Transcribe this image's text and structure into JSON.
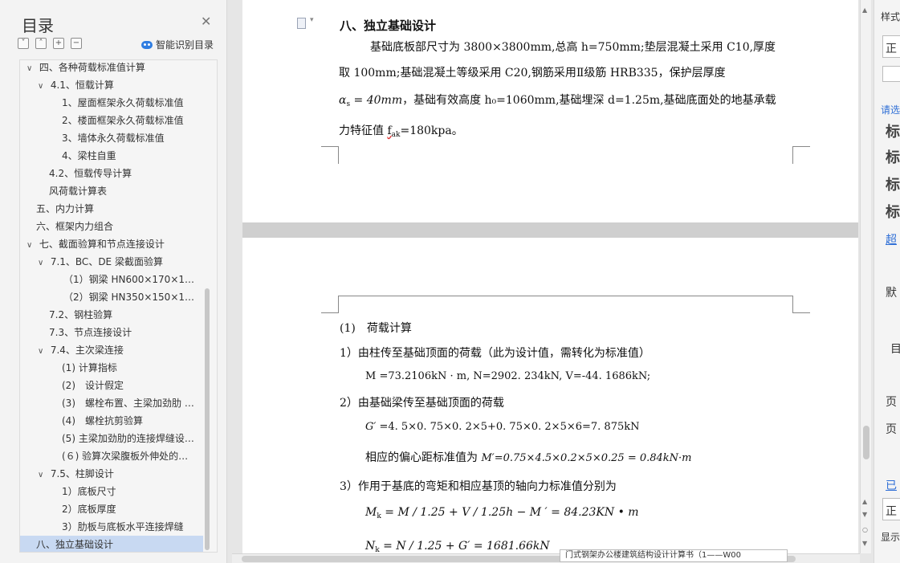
{
  "toc": {
    "title": "目录",
    "smart_label": "智能识别目录",
    "items": [
      {
        "label": "四、各种荷载标准值计算",
        "level": 1,
        "arrow": "∨"
      },
      {
        "label": "4.1、恒载计算",
        "level": 2,
        "arrow": "∨"
      },
      {
        "label": "1、屋面框架永久荷载标准值",
        "level": 3,
        "arrow": ""
      },
      {
        "label": "2、楼面框架永久荷载标准值",
        "level": 3,
        "arrow": ""
      },
      {
        "label": "3、墙体永久荷载标准值",
        "level": 3,
        "arrow": ""
      },
      {
        "label": "4、梁柱自重",
        "level": 3,
        "arrow": ""
      },
      {
        "label": "4.2、恒载传导计算",
        "level": 2,
        "arrow": ""
      },
      {
        "label": "风荷载计算表",
        "level": 2,
        "arrow": ""
      },
      {
        "label": "五、内力计算",
        "level": 1,
        "arrow": ""
      },
      {
        "label": "六、框架内力组合",
        "level": 1,
        "arrow": ""
      },
      {
        "label": "七、截面验算和节点连接设计",
        "level": 1,
        "arrow": "∨"
      },
      {
        "label": "7.1、BC、DE 梁截面验算",
        "level": 2,
        "arrow": "∨"
      },
      {
        "label": "（1）钢梁 HN600×170×16…",
        "level": 3,
        "arrow": ""
      },
      {
        "label": "（2）钢梁 HN350×150×12…",
        "level": 3,
        "arrow": ""
      },
      {
        "label": "7.2、钢柱验算",
        "level": 2,
        "arrow": ""
      },
      {
        "label": "7.3、节点连接设计",
        "level": 2,
        "arrow": ""
      },
      {
        "label": "7.4、主次梁连接",
        "level": 2,
        "arrow": "∨"
      },
      {
        "label": "(1) 计算指标",
        "level": 3,
        "arrow": ""
      },
      {
        "label": "(2)　设计假定",
        "level": 3,
        "arrow": ""
      },
      {
        "label": "(3)　螺栓布置、主梁加劲肋 …",
        "level": 3,
        "arrow": ""
      },
      {
        "label": "(4)　螺栓抗剪验算",
        "level": 3,
        "arrow": ""
      },
      {
        "label": "(5) 主梁加劲肋的连接焊缝设…",
        "level": 3,
        "arrow": ""
      },
      {
        "label": "(６) 验算次梁腹板外伸处的…",
        "level": 3,
        "arrow": ""
      },
      {
        "label": "7.5、柱脚设计",
        "level": 2,
        "arrow": "∨"
      },
      {
        "label": "1）底板尺寸",
        "level": 3,
        "arrow": ""
      },
      {
        "label": "2）底板厚度",
        "level": 3,
        "arrow": ""
      },
      {
        "label": "3）肋板与底板水平连接焊缝",
        "level": 3,
        "arrow": ""
      },
      {
        "label": "八、独立基础设计",
        "level": 1,
        "arrow": "",
        "active": true
      }
    ]
  },
  "page1": {
    "heading": "八、独立基础设计",
    "line1": "基础底板部尺寸为 3800×3800mm,总高 h=750mm;垫层混凝土采用 C10,厚度",
    "line2": "取 100mm;基础混凝土等级采用 C20,钢筋采用Ⅱ级筋 HRB335，保护层厚度",
    "line3_math": "α",
    "line3_sub": "s",
    "line3_eq": " = 40mm",
    "line3_rest": "，基础有效高度 h₀=1060mm,基础埋深 d=1.25m,基础底面处的地基承载",
    "line4_pre": "力特征值 ",
    "line4_f": "f",
    "line4_sub": "ak",
    "line4_post": "=180kpa。"
  },
  "page2": {
    "sec_title": "(1)　荷载计算",
    "item1": "1）由柱传至基础顶面的荷载（此为设计值，需转化为标准值）",
    "eq1": "M =73.2106kN · m, N=2902. 234kN, V=-44. 1686kN;",
    "item2": "2）由基础梁传至基础顶面的荷载",
    "eq2_g": "G′",
    "eq2": " =4. 5×0. 75×0. 2×5+0. 75×0. 2×5×6=7. 875kN",
    "eq3_pre": "相应的偏心距标准值为 ",
    "eq3": "M′=0.75×4.5×0.2×5×0.25 = 0.84kN·m",
    "item3": "3）作用于基底的弯矩和相应基顶的轴向力标准值分别为",
    "eq4": "M",
    "eq4_sub": "k",
    "eq4_rest": " = M / 1.25 + V / 1.25h − M ′ = 84.23KN • m",
    "eq5": "N",
    "eq5_sub": "k",
    "eq5_rest": " = N / 1.25 + G′ = 1681.66kN"
  },
  "bottom": {
    "tab_tip": "门式钢架办公楼建筑结构设计计算书（1——W00"
  },
  "right": {
    "styles": "样式",
    "box1": "正",
    "req": "请选",
    "s1": "标",
    "s2": "标",
    "s3": "标",
    "s4": "标",
    "link": "超",
    "def": "默",
    "mark": "目",
    "f1": "页",
    "f2": "页",
    "done": "已",
    "box2": "正",
    "show": "显示"
  }
}
